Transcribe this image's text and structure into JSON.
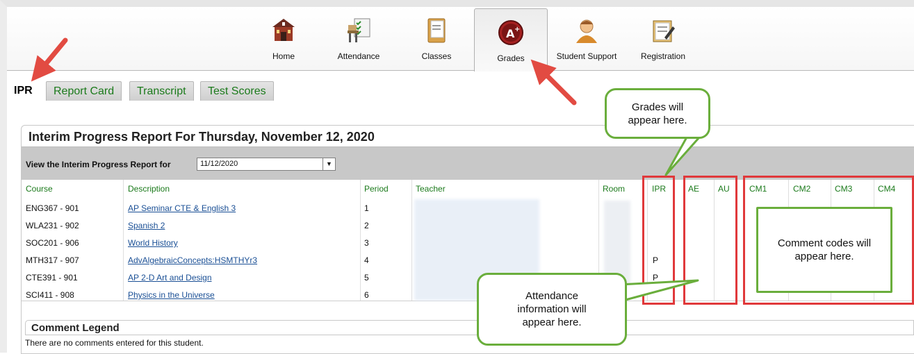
{
  "nav": {
    "items": [
      {
        "label": "Home",
        "icon": "schoolhouse-icon"
      },
      {
        "label": "Attendance",
        "icon": "desk-checklist-icon"
      },
      {
        "label": "Classes",
        "icon": "folder-icon"
      },
      {
        "label": "Grades",
        "icon": "a-plus-icon"
      },
      {
        "label": "Student Support",
        "icon": "person-icon"
      },
      {
        "label": "Registration",
        "icon": "clipboard-pencil-icon"
      }
    ],
    "active": "Grades"
  },
  "subtabs": {
    "items": [
      "IPR",
      "Report Card",
      "Transcript",
      "Test Scores"
    ],
    "active": "IPR"
  },
  "report": {
    "title": "Interim Progress Report For Thursday, November 12, 2020",
    "filter_label": "View the Interim Progress Report for",
    "date_value": "11/12/2020",
    "columns": [
      "Course",
      "Description",
      "Period",
      "Teacher",
      "Room",
      "IPR",
      "AE",
      "AU",
      "CM1",
      "CM2",
      "CM3",
      "CM4"
    ],
    "rows": [
      {
        "course": "ENG367 - 901",
        "description": "AP Seminar CTE & English 3",
        "period": "1",
        "ipr": ""
      },
      {
        "course": "WLA231 - 902",
        "description": "Spanish 2",
        "period": "2",
        "ipr": ""
      },
      {
        "course": "SOC201 - 906",
        "description": "World History",
        "period": "3",
        "ipr": ""
      },
      {
        "course": "MTH317 - 907",
        "description": "AdvAlgebraicConcepts:HSMTHYr3",
        "period": "4",
        "ipr": "P"
      },
      {
        "course": "CTE391 - 901",
        "description": "AP 2-D Art and Design",
        "period": "5",
        "ipr": "P"
      },
      {
        "course": "SCI411 - 908",
        "description": "Physics in the Universe",
        "period": "6",
        "ipr": ""
      }
    ]
  },
  "legend": {
    "title": "Comment Legend",
    "note": "There are no comments entered for this student."
  },
  "annotations": {
    "grades_callout": "Grades will appear here.",
    "attendance_callout": "Attendance information will appear here.",
    "comments_callout": "Comment codes will appear here."
  },
  "colors": {
    "tab_green": "#1b7a1b",
    "link_blue": "#1a4f95",
    "annotation_red": "#e0393b",
    "callout_green": "#6aae3c"
  }
}
